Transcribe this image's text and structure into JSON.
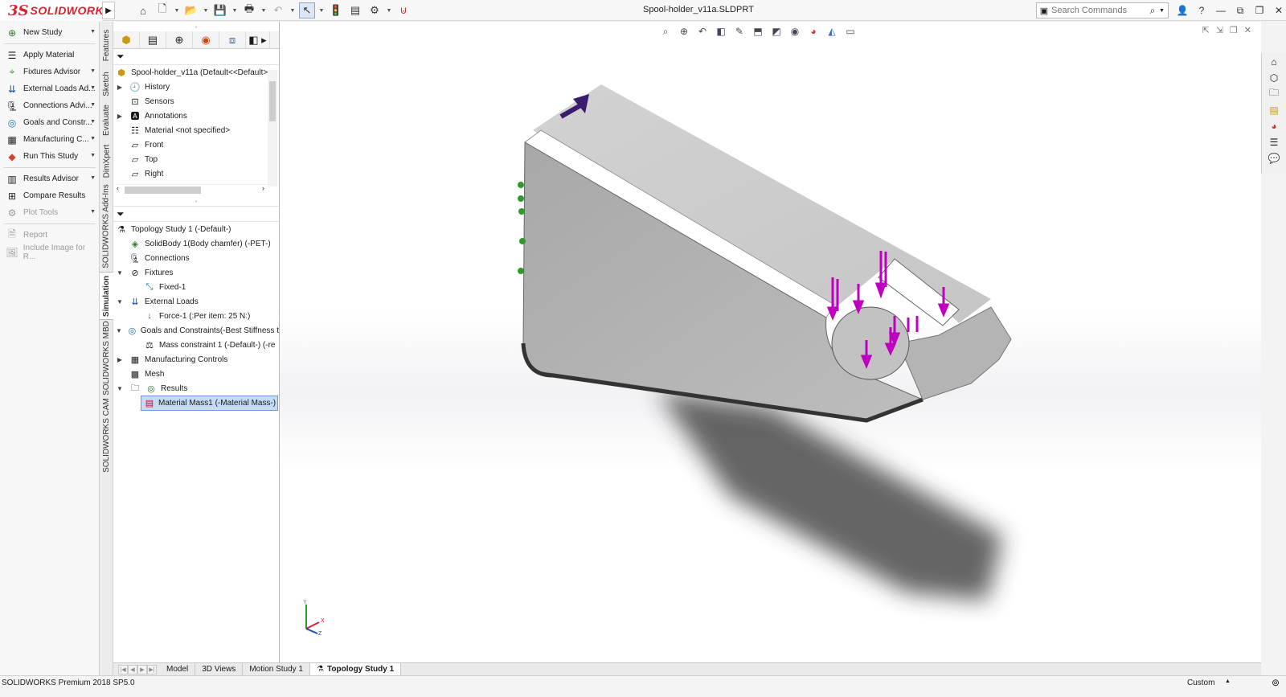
{
  "brand": {
    "mark": "3S",
    "name": "SOLIDWORKS"
  },
  "document_title": "Spool-holder_v11a.SLDPRT",
  "search": {
    "placeholder": "Search Commands"
  },
  "colors": {
    "accent_red": "#d9232e",
    "load_magenta": "#c000c0",
    "fixture_green": "#2e9a2e",
    "selection_blue": "#c5daf5"
  },
  "quick_access": [
    "home-icon",
    "new-document-icon",
    "open-icon",
    "save-icon",
    "print-icon",
    "undo-icon",
    "select-icon",
    "rebuild-icon",
    "file-properties-icon",
    "options-icon",
    "magnet-icon"
  ],
  "command_manager": {
    "items": [
      {
        "label": "New Study",
        "icon": "new-study-icon",
        "dropdown": true,
        "enabled": true
      },
      {
        "label": "Apply Material",
        "icon": "apply-material-icon",
        "dropdown": false,
        "enabled": true
      },
      {
        "label": "Fixtures Advisor",
        "icon": "fixtures-advisor-icon",
        "dropdown": true,
        "enabled": true
      },
      {
        "label": "External Loads Ad...",
        "icon": "external-loads-icon",
        "dropdown": true,
        "enabled": true
      },
      {
        "label": "Connections Advi...",
        "icon": "connections-icon",
        "dropdown": true,
        "enabled": true
      },
      {
        "label": "Goals and Constr...",
        "icon": "goals-icon",
        "dropdown": true,
        "enabled": true
      },
      {
        "label": "Manufacturing C...",
        "icon": "manufacturing-icon",
        "dropdown": true,
        "enabled": true
      },
      {
        "label": "Run This Study",
        "icon": "run-study-icon",
        "dropdown": true,
        "enabled": true
      },
      {
        "label": "Results Advisor",
        "icon": "results-advisor-icon",
        "dropdown": true,
        "enabled": true
      },
      {
        "label": "Compare Results",
        "icon": "compare-results-icon",
        "dropdown": false,
        "enabled": true
      },
      {
        "label": "Plot Tools",
        "icon": "plot-tools-icon",
        "dropdown": true,
        "enabled": false
      },
      {
        "label": "Report",
        "icon": "report-icon",
        "dropdown": false,
        "enabled": false
      },
      {
        "label": "Include Image for R...",
        "icon": "include-image-icon",
        "dropdown": false,
        "enabled": false
      }
    ]
  },
  "vertical_tabs": [
    "Features",
    "Sketch",
    "Evaluate",
    "DimXpert",
    "SOLIDWORKS Add-Ins",
    "Simulation",
    "SOLIDWORKS MBD",
    "SOLIDWORKS CAM"
  ],
  "active_vertical_tab": "Simulation",
  "feature_tree": {
    "root": "Spool-holder_v11a  (Default<<Default>",
    "items": [
      "History",
      "Sensors",
      "Annotations",
      "Material <not specified>",
      "Front",
      "Top",
      "Right"
    ]
  },
  "study_tree": {
    "root": "Topology Study 1 (-Default-)",
    "items": [
      "SolidBody 1(Body chamfer) (-PET-)",
      "Connections",
      "Fixtures",
      "Fixed-1",
      "External Loads",
      "Force-1 (:Per item: 25 N:)",
      "Goals and Constraints(-Best Stiffness t",
      "Mass constraint 1 (-Default-)  (-re",
      "Manufacturing Controls",
      "Mesh",
      "Results",
      "Material Mass1 (-Material Mass-)"
    ]
  },
  "bottom_tabs": [
    "Model",
    "3D Views",
    "Motion Study 1",
    "Topology Study 1"
  ],
  "active_bottom_tab": "Topology Study 1",
  "status": {
    "product": "SOLIDWORKS Premium 2018 SP5.0",
    "units": "Custom"
  }
}
